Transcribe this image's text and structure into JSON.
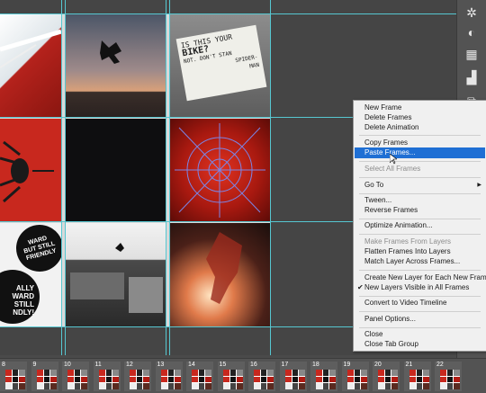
{
  "context_menu": {
    "items": [
      {
        "label": "New Frame",
        "state": "normal"
      },
      {
        "label": "Delete Frames",
        "state": "normal"
      },
      {
        "label": "Delete Animation",
        "state": "normal"
      },
      {
        "label": "Copy Frames",
        "state": "normal"
      },
      {
        "label": "Paste Frames...",
        "state": "highlighted"
      },
      {
        "label": "Select All Frames",
        "state": "disabled"
      },
      {
        "label": "Go To",
        "state": "normal",
        "submenu": true
      },
      {
        "label": "Tween...",
        "state": "normal"
      },
      {
        "label": "Reverse Frames",
        "state": "normal"
      },
      {
        "label": "Optimize Animation...",
        "state": "normal"
      },
      {
        "label": "Make Frames From Layers",
        "state": "disabled"
      },
      {
        "label": "Flatten Frames Into Layers",
        "state": "normal"
      },
      {
        "label": "Match Layer Across Frames...",
        "state": "normal"
      },
      {
        "label": "Create New Layer for Each New Frame",
        "state": "normal"
      },
      {
        "label": "New Layers Visible in All Frames",
        "state": "checked"
      },
      {
        "label": "Convert to Video Timeline",
        "state": "normal"
      },
      {
        "label": "Panel Options...",
        "state": "normal"
      },
      {
        "label": "Close",
        "state": "normal"
      },
      {
        "label": "Close Tab Group",
        "state": "normal"
      }
    ]
  },
  "canvas": {
    "note_text": [
      "IS THIS YOUR",
      "BIKE?",
      "NOT. DON'T STAN",
      "SPIDER-",
      "MAN"
    ],
    "sticker_text_1": [
      "WARD",
      "BUT STILL",
      "FRIENDLY"
    ],
    "sticker_text_2": [
      "ALLY",
      "WARD",
      "STILL",
      "NDLY!"
    ]
  },
  "frames": {
    "numbers": [
      "8",
      "9",
      "10",
      "11",
      "12",
      "13",
      "14",
      "15",
      "16",
      "17",
      "18",
      "19",
      "20",
      "21",
      "22"
    ]
  },
  "colors": {
    "accent_highlight": "#1f6fd4",
    "guide": "#56c7d1",
    "spider_red": "#c8281e"
  },
  "toolbar": {
    "icons": [
      "sun-icon",
      "palette-icon",
      "grid-icon",
      "histogram-icon",
      "layers-icon"
    ]
  }
}
